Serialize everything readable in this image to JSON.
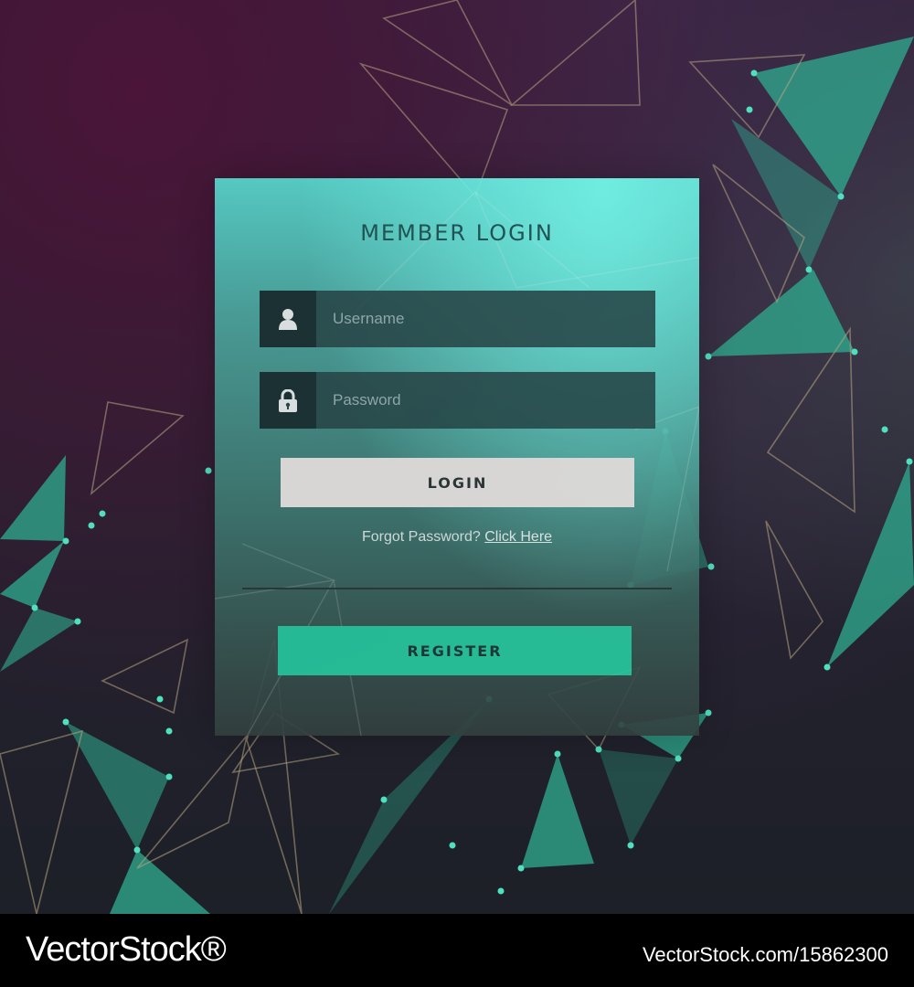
{
  "form": {
    "title": "MEMBER LOGIN",
    "username": {
      "placeholder": "Username",
      "icon": "user-icon"
    },
    "password": {
      "placeholder": "Password",
      "icon": "lock-icon"
    },
    "login_label": "LOGIN",
    "forgot_text": "Forgot Password?",
    "forgot_link": "Click Here",
    "register_label": "REGISTER"
  },
  "watermark": {
    "brand": "VectorStock®",
    "id": "VectorStock.com/15862300"
  },
  "colors": {
    "panel_top": "#57d8cd",
    "panel_bottom": "#33403f",
    "field_bg": "#264848",
    "login_button": "#e6e6e3",
    "register_button": "#27c79e",
    "accent_teal": "#2fbf9a",
    "background": "#262230"
  }
}
